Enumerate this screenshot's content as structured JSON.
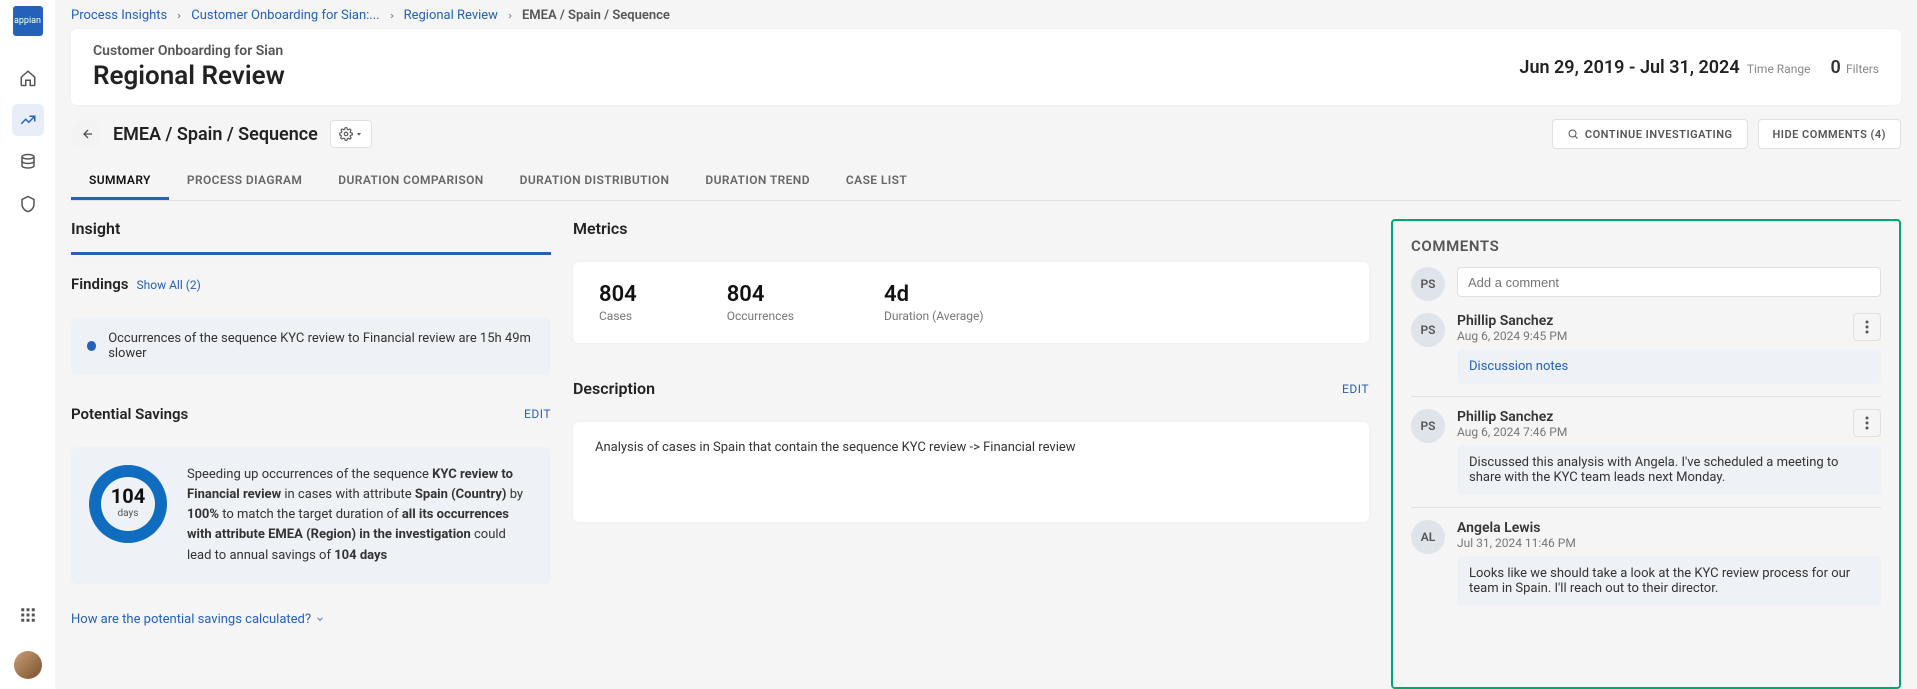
{
  "breadcrumbs": {
    "items": [
      {
        "label": "Process Insights",
        "link": true
      },
      {
        "label": "Customer Onboarding for Sian:...",
        "link": true
      },
      {
        "label": "Regional Review",
        "link": true
      },
      {
        "label": "EMEA / Spain / Sequence",
        "link": false
      }
    ]
  },
  "header": {
    "subtitle": "Customer Onboarding for Sian",
    "title": "Regional Review",
    "date_range": "Jun 29, 2019 - Jul 31, 2024",
    "date_range_label": "Time Range",
    "filters_count": "0",
    "filters_label": "Filters"
  },
  "toolbar": {
    "segment": "EMEA / Spain / Sequence",
    "continue_label": "CONTINUE INVESTIGATING",
    "hide_label": "HIDE COMMENTS (4)"
  },
  "tabs": [
    {
      "label": "SUMMARY",
      "active": true
    },
    {
      "label": "PROCESS DIAGRAM",
      "active": false
    },
    {
      "label": "DURATION COMPARISON",
      "active": false
    },
    {
      "label": "DURATION DISTRIBUTION",
      "active": false
    },
    {
      "label": "DURATION TREND",
      "active": false
    },
    {
      "label": "CASE LIST",
      "active": false
    }
  ],
  "insight": {
    "title": "Insight",
    "findings_label": "Findings",
    "show_all": "Show All (2)",
    "finding_text": "Occurrences of the sequence KYC review to Financial review are 15h 49m slower",
    "savings_label": "Potential Savings",
    "edit": "EDIT",
    "donut_num": "104",
    "donut_label": "days",
    "savings_html": "Speeding up occurrences of the sequence <b>KYC review to Financial review</b> in cases with attribute <b>Spain (Country)</b> by <b>100%</b> to match the target duration of <b>all its occurrences with attribute EMEA (Region) in the investigation</b> could lead to annual savings of <b>104 days</b>",
    "help": "How are the potential savings calculated?"
  },
  "metrics": {
    "title": "Metrics",
    "items": [
      {
        "num": "804",
        "label": "Cases"
      },
      {
        "num": "804",
        "label": "Occurrences"
      },
      {
        "num": "4d",
        "label": "Duration (Average)"
      }
    ]
  },
  "description": {
    "title": "Description",
    "edit": "EDIT",
    "text": "Analysis of cases in Spain that contain the sequence KYC review -> Financial review"
  },
  "comments": {
    "title": "COMMENTS",
    "placeholder": "Add a comment",
    "current_user_initials": "PS",
    "items": [
      {
        "initials": "PS",
        "user": "Phillip Sanchez",
        "time": "Aug 6, 2024 9:45 PM",
        "link": "Discussion notes",
        "text": ""
      },
      {
        "initials": "PS",
        "user": "Phillip Sanchez",
        "time": "Aug 6, 2024 7:46 PM",
        "link": "",
        "text": "Discussed this analysis with Angela. I've scheduled a meeting to share with the KYC team leads next Monday."
      },
      {
        "initials": "AL",
        "user": "Angela Lewis",
        "time": "Jul 31, 2024 11:46 PM",
        "link": "",
        "text": "Looks like we should take a look at the KYC review process for our team in Spain.  I'll reach out to their director."
      }
    ]
  }
}
